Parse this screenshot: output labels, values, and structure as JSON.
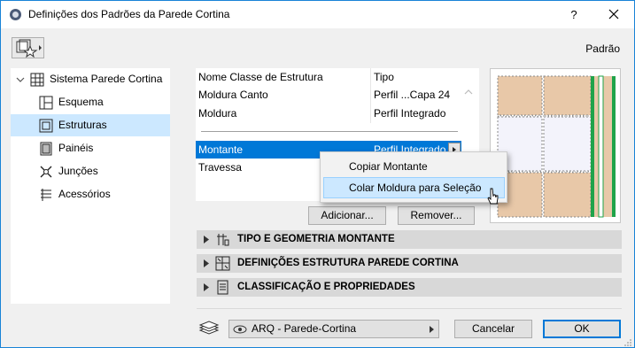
{
  "window": {
    "title": "Definições dos Padrões da Parede Cortina",
    "help_label": "?",
    "close_icon": "close-icon",
    "accent": "#1883d7"
  },
  "toolbar": {
    "favorites_icon": "favorites-icon",
    "preset_label": "Padrão"
  },
  "tree": {
    "root_label": "Sistema Parede Cortina",
    "items": [
      {
        "label": "Esquema",
        "icon": "scheme-icon"
      },
      {
        "label": "Estruturas",
        "icon": "frame-icon",
        "selected": true
      },
      {
        "label": "Painéis",
        "icon": "panel-icon"
      },
      {
        "label": "Junções",
        "icon": "junction-icon"
      },
      {
        "label": "Acessórios",
        "icon": "accessory-icon"
      }
    ]
  },
  "frame_list": {
    "rows": [
      {
        "name": "Nome Classe de Estrutura",
        "type": "Tipo"
      },
      {
        "name": "Moldura Canto",
        "type": "Perfil ...Capa 24"
      },
      {
        "name": "Moldura",
        "type": "Perfil Integrado"
      }
    ],
    "rows2": [
      {
        "name": "Montante",
        "type": "Perfil Integrado",
        "selected": true
      },
      {
        "name": "Travessa",
        "type": ""
      }
    ],
    "selected_color": "#0078d7"
  },
  "context_menu": {
    "items": [
      {
        "label": "Copiar Montante"
      },
      {
        "label": "Colar Moldura para Seleção",
        "hover": true
      }
    ]
  },
  "buttons": {
    "add": "Adicionar...",
    "remove": "Remover...",
    "cancel": "Cancelar",
    "ok": "OK"
  },
  "sections": [
    {
      "label": "TIPO E GEOMETRIA MONTANTE",
      "icon": "geometry-icon"
    },
    {
      "label": "DEFINIÇÕES ESTRUTURA PAREDE CORTINA",
      "icon": "settings-icon"
    },
    {
      "label": "CLASSIFICAÇÃO E PROPRIEDADES",
      "icon": "properties-icon"
    }
  ],
  "footer": {
    "layer_icon": "layer-icon",
    "layer_value": "ARQ - Parede-Cortina"
  },
  "preview": {
    "panel_color": "#e8c8a8",
    "frame_color": "#1fa34a",
    "selected_panel_color": "#f3f3fb"
  }
}
